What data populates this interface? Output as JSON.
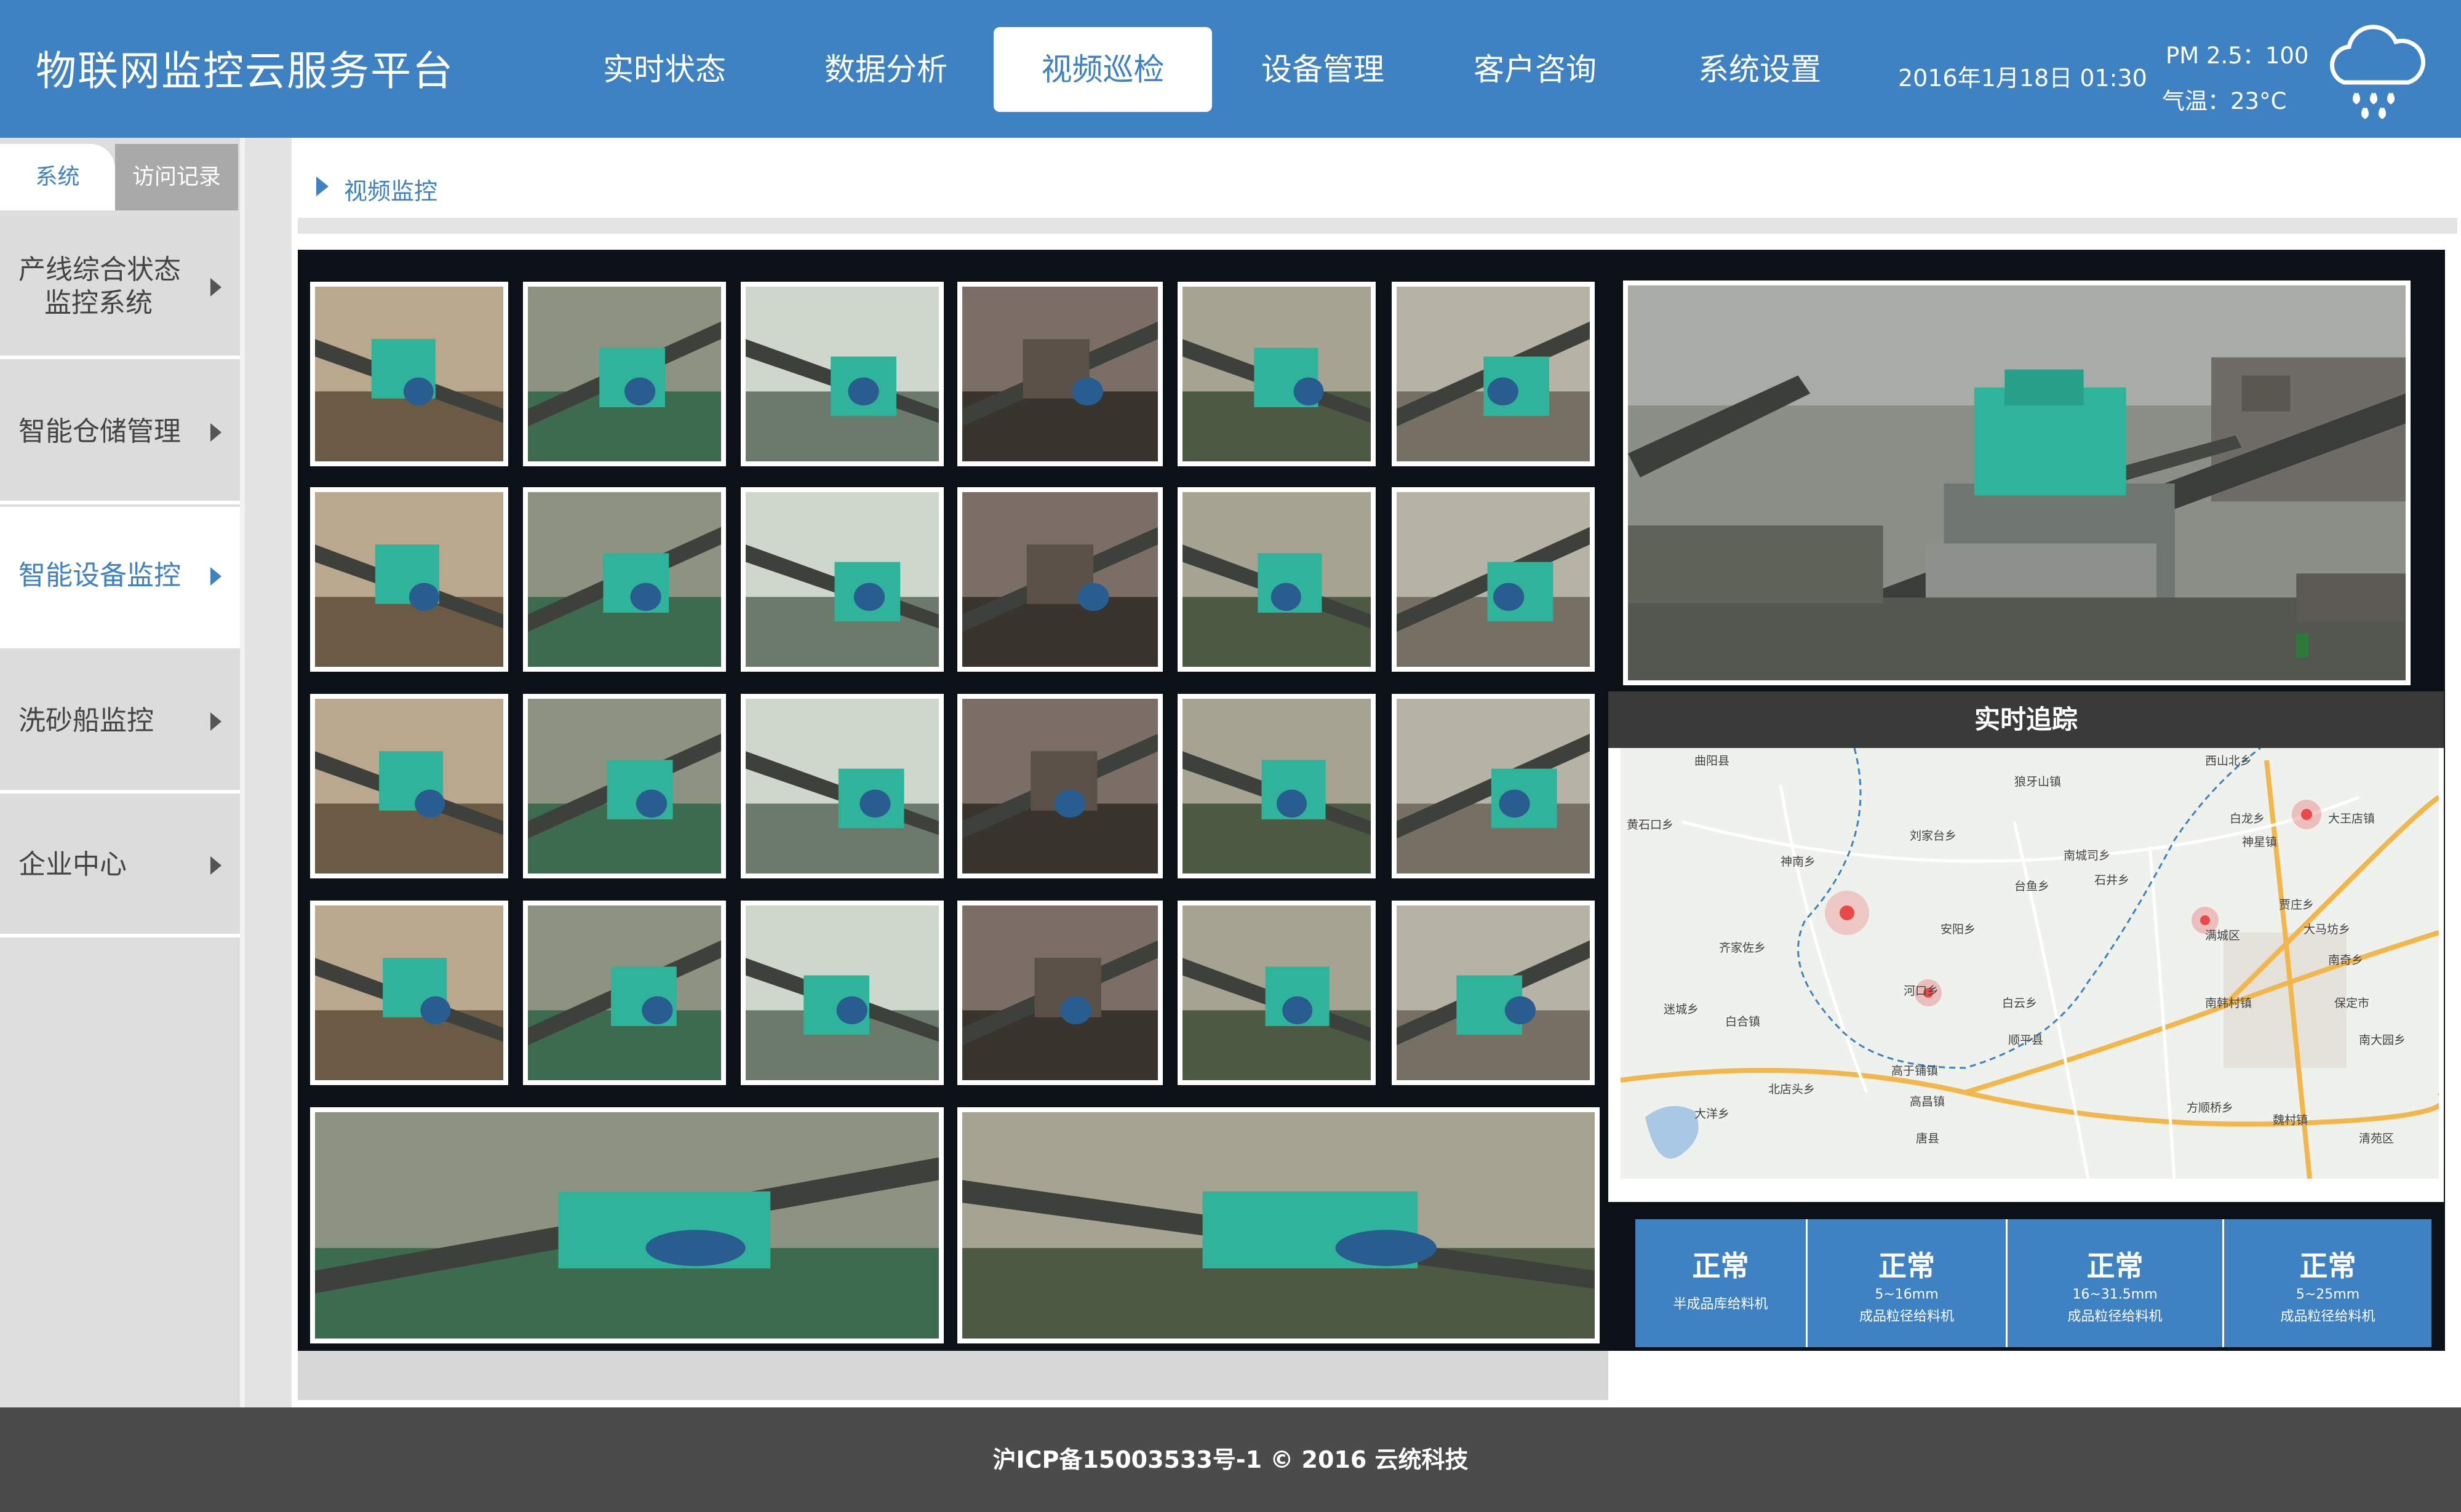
{
  "header": {
    "title": "物联网监控云服务平台",
    "nav": [
      {
        "label": "实时状态",
        "active": false
      },
      {
        "label": "数据分析",
        "active": false
      },
      {
        "label": "视频巡检",
        "active": true
      },
      {
        "label": "设备管理",
        "active": false
      },
      {
        "label": "客户咨询",
        "active": false
      },
      {
        "label": "系统设置",
        "active": false
      }
    ],
    "datetime": "2016年1月18日 01:30",
    "pm25": "PM 2.5：100",
    "temperature": "气温：23°C",
    "weather_icon": "rain-cloud-icon"
  },
  "sidebar": {
    "tabs": [
      {
        "label": "系统",
        "active": true
      },
      {
        "label": "访问记录",
        "active": false
      }
    ],
    "items": [
      {
        "label_line1": "产线综合状态",
        "label_line2": "监控系统",
        "active": false
      },
      {
        "label_line1": "智能仓储管理",
        "label_line2": "",
        "active": false
      },
      {
        "label_line1": "智能设备监控",
        "label_line2": "",
        "active": true
      },
      {
        "label_line1": "洗砂船监控",
        "label_line2": "",
        "active": false
      },
      {
        "label_line1": "企业中心",
        "label_line2": "",
        "active": false
      }
    ]
  },
  "breadcrumb": "视频监控",
  "map": {
    "title": "实时追踪",
    "labels": [
      "曲阳县",
      "西山北乡",
      "狼牙山镇",
      "黄石口乡",
      "白龙乡",
      "大王店镇",
      "刘家台乡",
      "神星镇",
      "南城司乡",
      "石井乡",
      "神南乡",
      "台鱼乡",
      "安阳乡",
      "齐家佐乡",
      "满城区",
      "贾庄乡",
      "大马坊乡",
      "南奇乡",
      "河口乡",
      "南韩村镇",
      "保定市",
      "迷城乡",
      "白合镇",
      "白云乡",
      "顺平县",
      "高于铺镇",
      "北店头乡",
      "大洋乡",
      "高昌镇",
      "方顺桥乡",
      "魏村镇",
      "唐县",
      "清苑区",
      "南大园乡"
    ],
    "markers": 4
  },
  "status": [
    {
      "state": "正常",
      "line1": "",
      "line2": "半成品库给料机"
    },
    {
      "state": "正常",
      "line1": "5~16mm",
      "line2": "成品粒径给料机"
    },
    {
      "state": "正常",
      "line1": "16~31.5mm",
      "line2": "成品粒径给料机"
    },
    {
      "state": "正常",
      "line1": "5~25mm",
      "line2": "成品粒径给料机"
    }
  ],
  "footer": "沪ICP备15003533号-1 © 2016 云统科技",
  "colors": {
    "primary": "#3f82c4",
    "footer": "#4b4b4b",
    "accent_green": "#2fb39a"
  }
}
